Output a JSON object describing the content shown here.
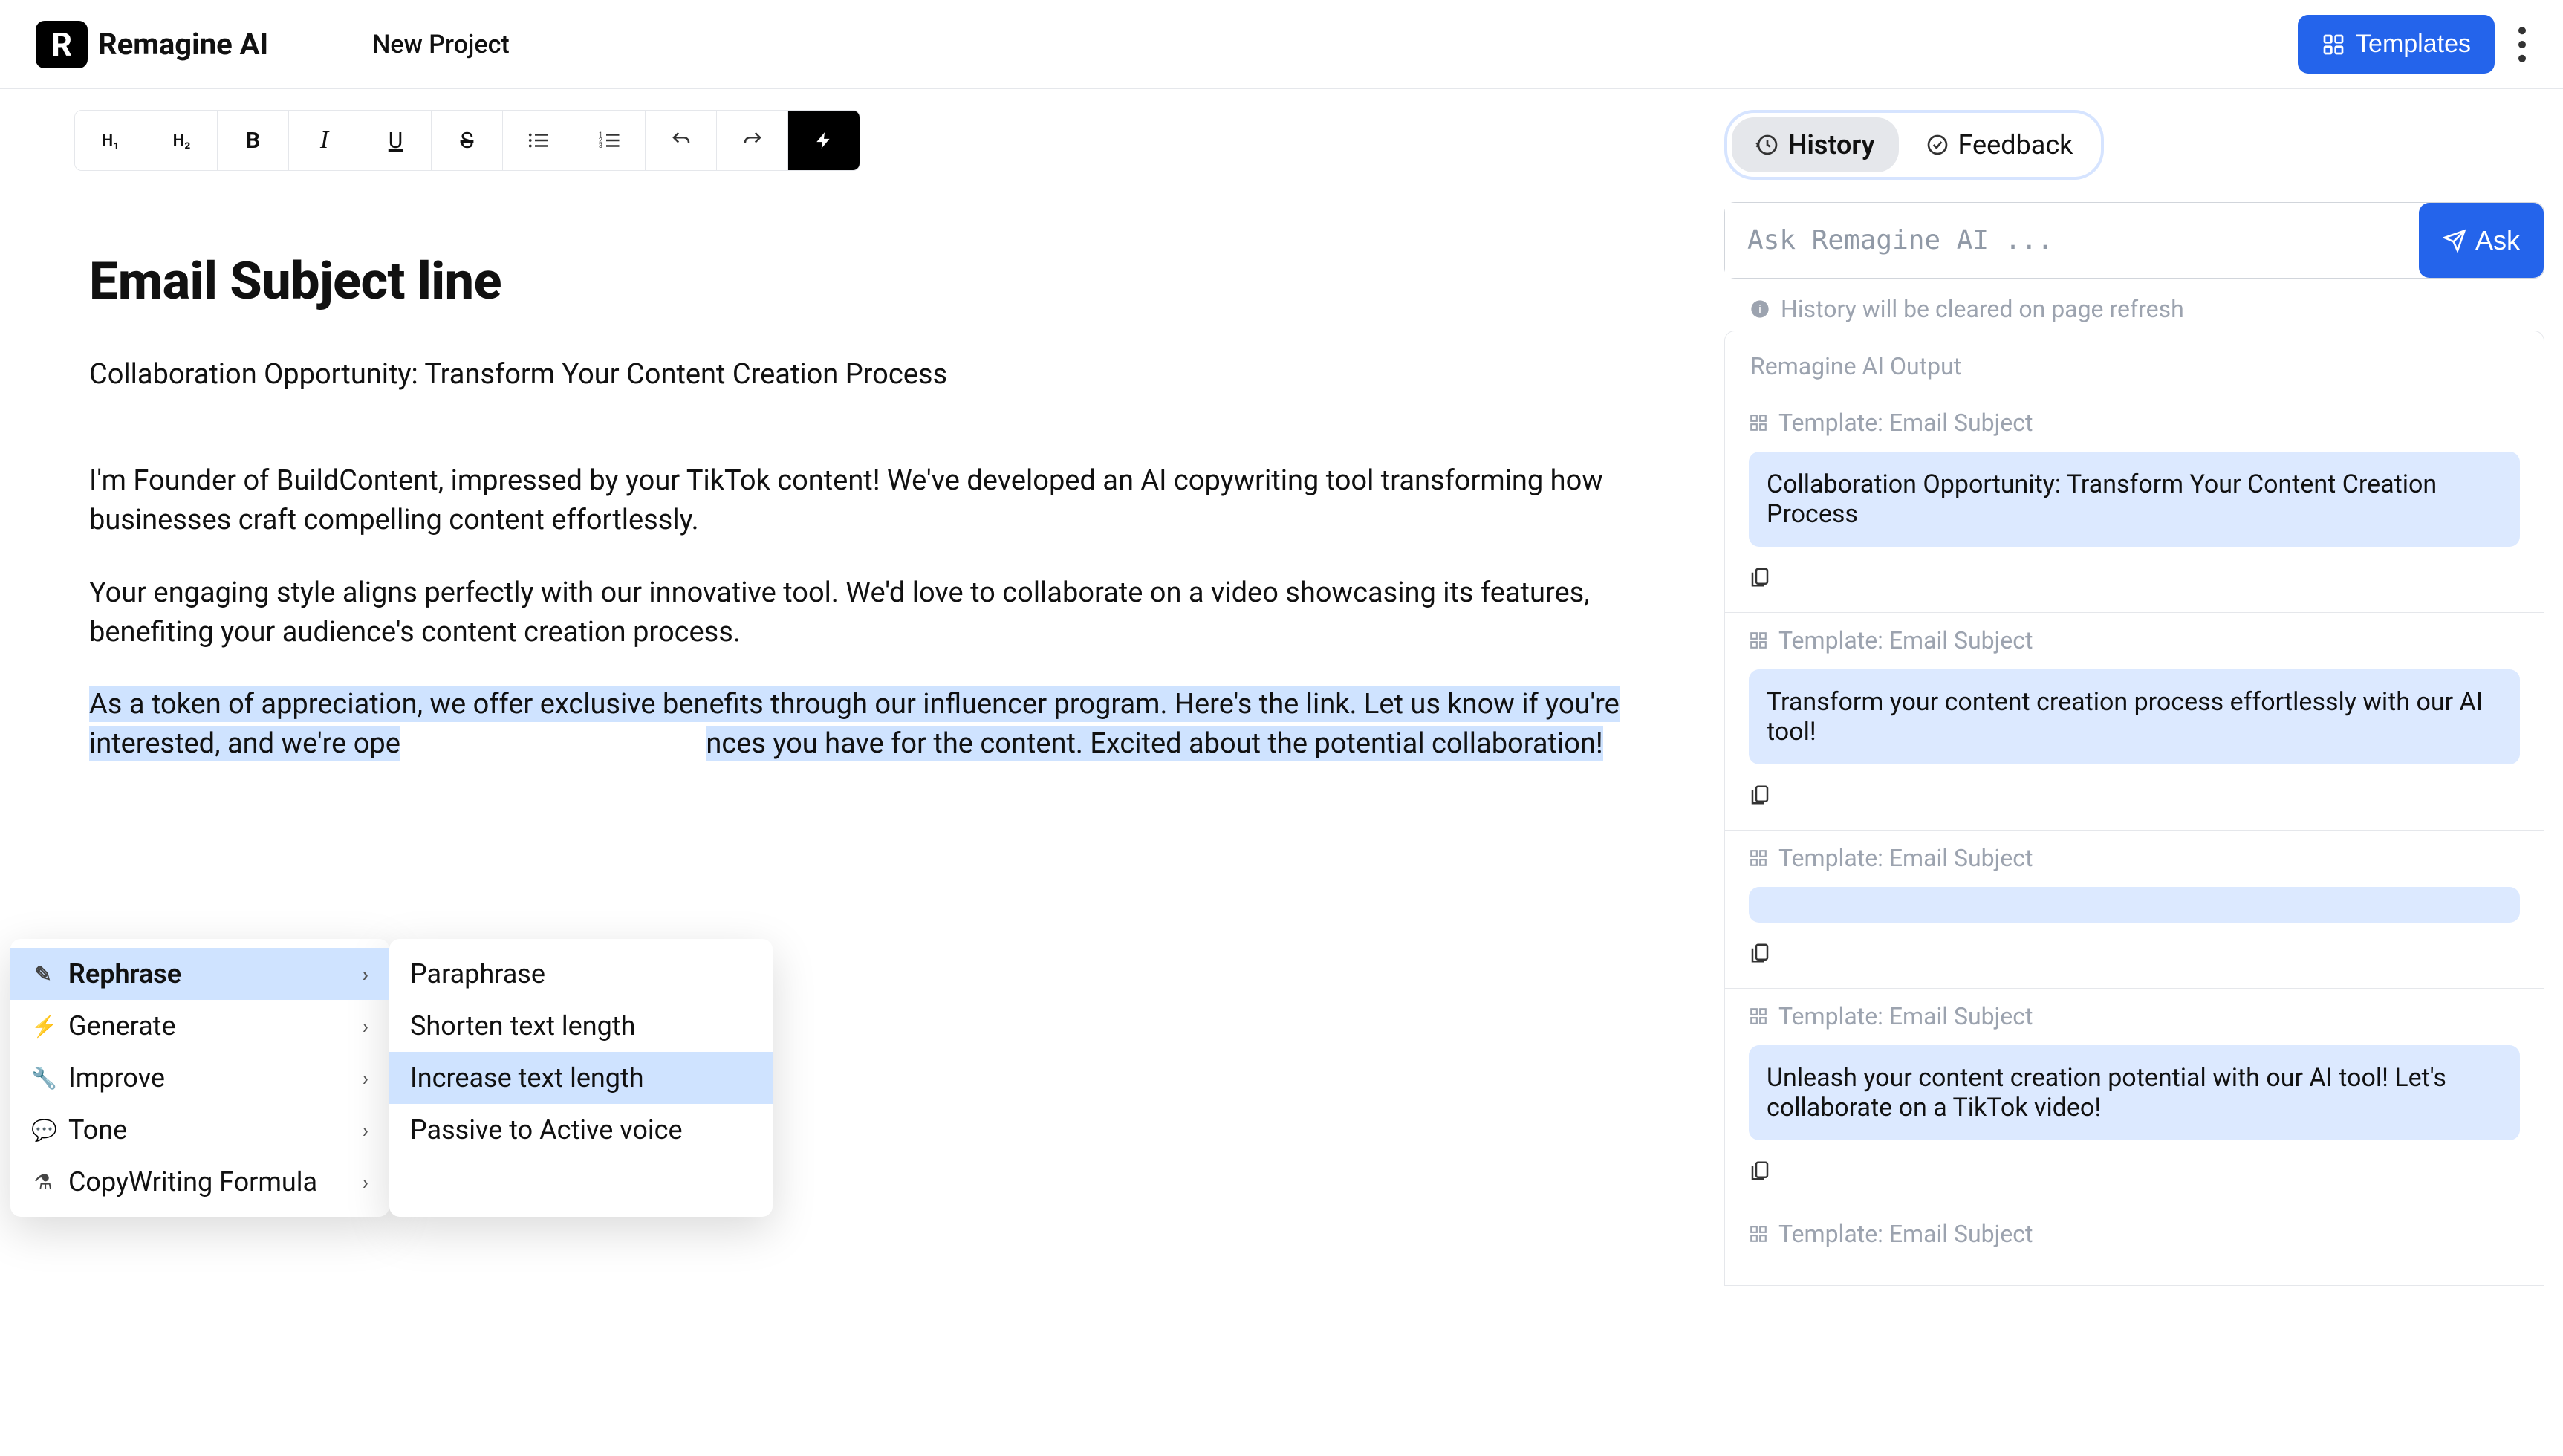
{
  "header": {
    "brand": "Remagine AI",
    "logo_letter": "R",
    "project_title": "New Project",
    "templates_button": "Templates"
  },
  "toolbar": {
    "h1": "H₁",
    "h2": "H₂",
    "bold": "B",
    "italic": "I",
    "underline": "U",
    "strike": "S"
  },
  "document": {
    "heading": "Email Subject line",
    "p1": "Collaboration Opportunity: Transform Your Content Creation Process",
    "p2": "I'm Founder of BuildContent, impressed by your TikTok content! We've developed an AI copywriting tool transforming how businesses craft compelling content effortlessly.",
    "p3": "Your engaging style aligns perfectly with our innovative tool. We'd love to collaborate on a video showcasing its features, benefiting your audience's content creation process.",
    "p4_before": "As a token of appreciation, we offer exclusive benefits through our influencer program. Here's the link. Let us know if you're interested, and we're ope",
    "p4_after": "nces you have for the content. Excited about the potential collaboration!"
  },
  "context_menu": {
    "primary": [
      {
        "label": "Rephrase",
        "selected": true
      },
      {
        "label": "Generate",
        "selected": false
      },
      {
        "label": "Improve",
        "selected": false
      },
      {
        "label": "Tone",
        "selected": false
      },
      {
        "label": "CopyWriting Formula",
        "selected": false
      }
    ],
    "secondary": [
      {
        "label": "Paraphrase",
        "hover": false
      },
      {
        "label": "Shorten text length",
        "hover": false
      },
      {
        "label": "Increase text length",
        "hover": true
      },
      {
        "label": "Passive to Active voice",
        "hover": false
      }
    ]
  },
  "sidebar": {
    "tabs": {
      "history": "History",
      "feedback": "Feedback"
    },
    "ask_placeholder": "Ask Remagine AI ...",
    "ask_button": "Ask",
    "history_note": "History will be cleared on page refresh",
    "output_header": "Remagine AI Output",
    "template_label": "Template: Email Subject",
    "outputs": [
      "Collaboration Opportunity: Transform Your Content Creation Process",
      "Transform your content creation process effortlessly with our AI tool!",
      "",
      "Unleash your content creation potential with our AI tool! Let's collaborate on a TikTok video!"
    ],
    "template_label_bottom": "Template: Email Subject"
  }
}
